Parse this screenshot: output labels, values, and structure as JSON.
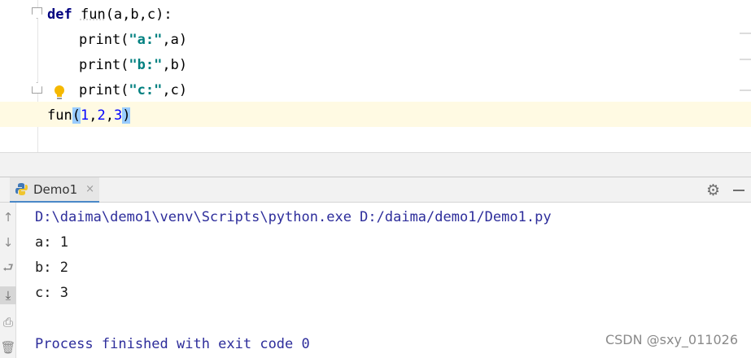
{
  "editor": {
    "lines": {
      "l1_kw": "def",
      "l1_name": "fun",
      "l1_rest": "(a,b,c):",
      "l2_call": "print(",
      "l2_str": "\"a:\"",
      "l2_rest": ",a)",
      "l3_call": "print(",
      "l3_str": "\"b:\"",
      "l3_rest": ",b)",
      "l4_call": "print(",
      "l4_str": "\"c:\"",
      "l4_rest": ",c)",
      "l5_name": "fun",
      "l5_open": "(",
      "l5_n1": "1",
      "l5_c1": ",",
      "l5_n2": "2",
      "l5_c2": ",",
      "l5_n3": "3",
      "l5_close": ")"
    }
  },
  "run_panel": {
    "tab_label": "Demo1",
    "tab_close": "×",
    "settings_icon": "gear-icon",
    "icons": [
      "python-icon",
      "arrow-up-icon",
      "arrow-down-icon",
      "soft-wrap-icon",
      "scroll-to-end-icon",
      "print-icon",
      "trash-icon"
    ]
  },
  "console": {
    "command": "D:\\daima\\demo1\\venv\\Scripts\\python.exe D:/daima/demo1/Demo1.py",
    "out1": "a: 1",
    "out2": "b: 2",
    "out3": "c: 3",
    "exit": "Process finished with exit code 0"
  },
  "watermark": "CSDN @sxy_011026",
  "colors": {
    "keyword": "#000080",
    "string": "#008080",
    "number": "#0000ff",
    "console_text": "#2d2d9b",
    "current_line": "#fffae3"
  }
}
